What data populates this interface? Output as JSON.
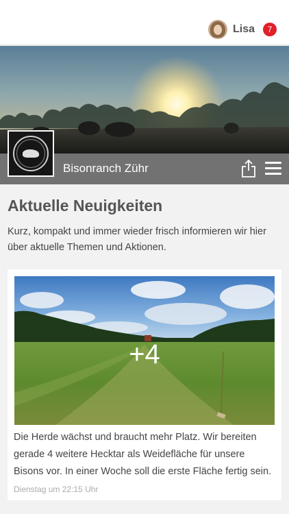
{
  "user": {
    "name": "Lisa",
    "notification_count": "7"
  },
  "header": {
    "site_name": "Bisonranch Zühr",
    "logo_text": "BISON RANCH ZÜHR",
    "icons": {
      "share": "share-icon",
      "menu": "hamburger-menu-icon"
    }
  },
  "news": {
    "title": "Aktuelle Neuigkeiten",
    "intro": "Kurz, kompakt und immer wieder frisch informieren wir hier über aktuelle Themen und Aktionen."
  },
  "post": {
    "more_photos": "+4",
    "text": "Die Herde wächst und braucht mehr Platz. Wir bereiten gerade 4 weitere Hecktar als Weidefläche für unsere Bisons vor. In einer Woche soll die erste Fläche fertig sein.",
    "timestamp": "Dienstag um 22:15 Uhr"
  },
  "colors": {
    "badge": "#e0202a",
    "titlebar": "#727272",
    "background": "#f2f2f2"
  }
}
